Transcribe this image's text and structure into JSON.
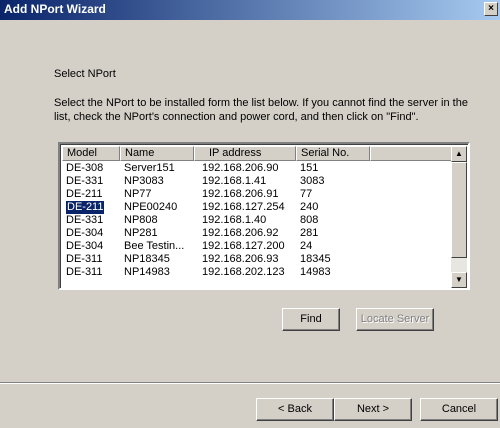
{
  "window": {
    "title": "Add NPort Wizard",
    "close_glyph": "×"
  },
  "page": {
    "heading": "Select NPort",
    "instructions": "Select the NPort to be installed form the list below. If you cannot find the server in the list, check the NPort's connection and power cord, and then click on \"Find\"."
  },
  "table": {
    "columns": [
      "Model",
      "Name",
      "IP address",
      "Serial No."
    ],
    "rows": [
      [
        "DE-308",
        "Server151",
        "192.168.206.90",
        "151"
      ],
      [
        "DE-331",
        "NP3083",
        "192.168.1.41",
        "3083"
      ],
      [
        "DE-211",
        "NP77",
        "192.168.206.91",
        "77"
      ],
      [
        "DE-211",
        "NPE00240",
        "192.168.127.254",
        "240"
      ],
      [
        "DE-331",
        "NP808",
        "192.168.1.40",
        "808"
      ],
      [
        "DE-304",
        "NP281",
        "192.168.206.92",
        "281"
      ],
      [
        "DE-304",
        "Bee Testin...",
        "192.168.127.200",
        "24"
      ],
      [
        "DE-311",
        "NP18345",
        "192.168.206.93",
        "18345"
      ],
      [
        "DE-311",
        "NP14983",
        "192.168.202.123",
        "14983"
      ]
    ],
    "selected_row": 3
  },
  "buttons": {
    "find": "Find",
    "locate_server": "Locate Server",
    "back": "< Back",
    "next": "Next >",
    "cancel": "Cancel"
  }
}
